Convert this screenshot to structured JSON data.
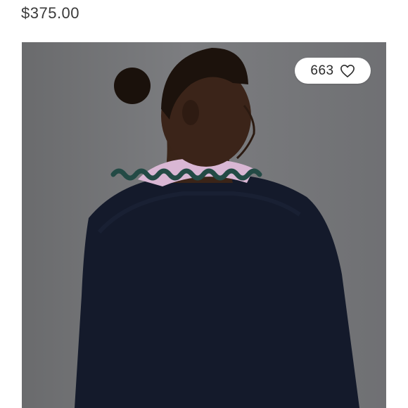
{
  "listing": {
    "price": "$375.00"
  },
  "photo": {
    "icon": "product-photo"
  },
  "likes": {
    "count": "663",
    "icon": "heart-outline-icon"
  }
}
